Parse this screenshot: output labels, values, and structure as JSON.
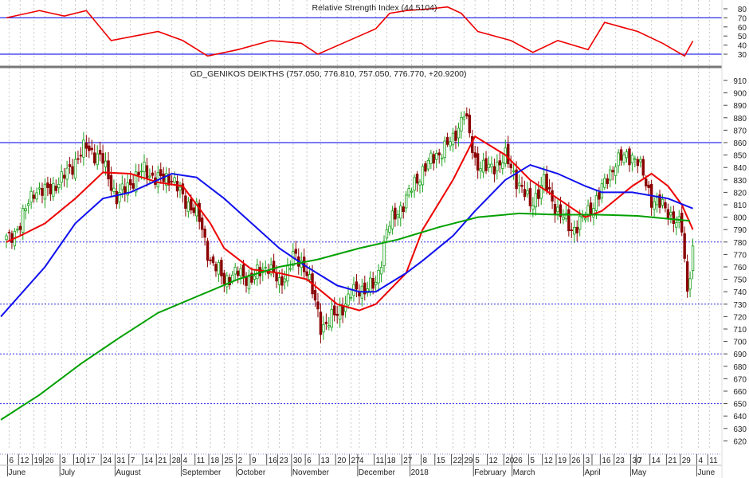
{
  "chart_data": [
    {
      "type": "line",
      "panel": "rsi",
      "title": "Relative Strength Index (44.5104)",
      "ylim": [
        20,
        85
      ],
      "yticks": [
        80,
        70,
        60,
        50,
        40,
        30
      ],
      "reference_lines": [
        70,
        30
      ],
      "colors": {
        "rsi": "#ee0000",
        "reference": "#2a2aee"
      },
      "series": [
        {
          "name": "RSI",
          "points": [
            [
              0,
              70
            ],
            [
              12,
              78
            ],
            [
              21,
              72
            ],
            [
              29,
              78
            ],
            [
              38,
              45
            ],
            [
              50,
              52
            ],
            [
              55,
              55
            ],
            [
              64,
              45
            ],
            [
              73,
              28
            ],
            [
              84,
              35
            ],
            [
              96,
              45
            ],
            [
              107,
              42
            ],
            [
              113,
              30
            ],
            [
              122,
              42
            ],
            [
              128,
              50
            ],
            [
              134,
              58
            ],
            [
              139,
              75
            ],
            [
              145,
              78
            ],
            [
              154,
              80
            ],
            [
              160,
              82
            ],
            [
              165,
              75
            ],
            [
              171,
              55
            ],
            [
              183,
              45
            ],
            [
              191,
              32
            ],
            [
              200,
              45
            ],
            [
              211,
              35
            ],
            [
              217,
              65
            ],
            [
              223,
              60
            ],
            [
              229,
              55
            ],
            [
              238,
              42
            ],
            [
              246,
              28
            ],
            [
              249,
              44.5
            ]
          ]
        }
      ]
    },
    {
      "type": "candlestick",
      "panel": "price",
      "title": "GD_GENIKOS DEIKTHS (757.050, 776.810, 757.050, 776.770, +20.9200)",
      "ylim": [
        610,
        915
      ],
      "yticks": [
        910,
        900,
        890,
        880,
        870,
        860,
        850,
        840,
        830,
        820,
        810,
        800,
        790,
        780,
        770,
        760,
        750,
        740,
        730,
        720,
        710,
        700,
        690,
        680,
        670,
        660,
        650,
        640,
        630,
        620
      ],
      "reference_lines": [
        {
          "value": 860,
          "style": "solid"
        },
        {
          "value": 780,
          "style": "dotted"
        },
        {
          "value": 730,
          "style": "dotted"
        },
        {
          "value": 690,
          "style": "dotted"
        },
        {
          "value": 650,
          "style": "dotted"
        }
      ],
      "colors": {
        "up": "#1aa11a",
        "down": "#8b0000",
        "ma_short": "#ee0000",
        "ma_mid": "#1010ee",
        "ma_long": "#00a000",
        "reference": "#2a2aee"
      },
      "close_points": [
        [
          1,
          782
        ],
        [
          5,
          795
        ],
        [
          10,
          822
        ],
        [
          14,
          820
        ],
        [
          20,
          830
        ],
        [
          25,
          845
        ],
        [
          29,
          857
        ],
        [
          35,
          845
        ],
        [
          40,
          815
        ],
        [
          45,
          828
        ],
        [
          50,
          838
        ],
        [
          55,
          830
        ],
        [
          60,
          832
        ],
        [
          64,
          815
        ],
        [
          69,
          805
        ],
        [
          74,
          765
        ],
        [
          79,
          750
        ],
        [
          84,
          755
        ],
        [
          89,
          750
        ],
        [
          95,
          762
        ],
        [
          99,
          745
        ],
        [
          104,
          768
        ],
        [
          109,
          758
        ],
        [
          114,
          712
        ],
        [
          120,
          722
        ],
        [
          125,
          738
        ],
        [
          128,
          742
        ],
        [
          134,
          745
        ],
        [
          138,
          790
        ],
        [
          145,
          815
        ],
        [
          151,
          838
        ],
        [
          156,
          850
        ],
        [
          162,
          862
        ],
        [
          166,
          885
        ],
        [
          170,
          845
        ],
        [
          175,
          838
        ],
        [
          181,
          848
        ],
        [
          184,
          835
        ],
        [
          190,
          810
        ],
        [
          195,
          828
        ],
        [
          200,
          805
        ],
        [
          205,
          790
        ],
        [
          210,
          800
        ],
        [
          216,
          822
        ],
        [
          221,
          845
        ],
        [
          227,
          850
        ],
        [
          229,
          845
        ],
        [
          234,
          815
        ],
        [
          240,
          805
        ],
        [
          245,
          790
        ],
        [
          247,
          740
        ],
        [
          249,
          776.77
        ]
      ],
      "last_bar": {
        "open": 757.05,
        "high": 776.81,
        "low": 757.05,
        "close": 776.77,
        "change": 20.92
      },
      "series": [
        {
          "name": "MA short",
          "color_key": "ma_short",
          "points": [
            [
              0,
              780
            ],
            [
              5,
              785
            ],
            [
              14,
              795
            ],
            [
              25,
              815
            ],
            [
              35,
              836
            ],
            [
              45,
              835
            ],
            [
              55,
              828
            ],
            [
              64,
              825
            ],
            [
              74,
              795
            ],
            [
              79,
              775
            ],
            [
              89,
              758
            ],
            [
              99,
              755
            ],
            [
              109,
              750
            ],
            [
              120,
              730
            ],
            [
              128,
              725
            ],
            [
              134,
              730
            ],
            [
              145,
              755
            ],
            [
              151,
              790
            ],
            [
              162,
              830
            ],
            [
              170,
              865
            ],
            [
              181,
              850
            ],
            [
              190,
              830
            ],
            [
              200,
              815
            ],
            [
              210,
              800
            ],
            [
              216,
              805
            ],
            [
              227,
              825
            ],
            [
              234,
              835
            ],
            [
              240,
              825
            ],
            [
              245,
              810
            ],
            [
              249,
              790
            ]
          ]
        },
        {
          "name": "MA mid",
          "color_key": "ma_mid",
          "points": [
            [
              -2,
              720
            ],
            [
              14,
              760
            ],
            [
              25,
              795
            ],
            [
              35,
              815
            ],
            [
              45,
              820
            ],
            [
              55,
              830
            ],
            [
              60,
              835
            ],
            [
              69,
              832
            ],
            [
              79,
              815
            ],
            [
              89,
              795
            ],
            [
              99,
              775
            ],
            [
              109,
              760
            ],
            [
              120,
              745
            ],
            [
              128,
              740
            ],
            [
              134,
              740
            ],
            [
              145,
              755
            ],
            [
              151,
              765
            ],
            [
              162,
              785
            ],
            [
              170,
              805
            ],
            [
              181,
              830
            ],
            [
              190,
              842
            ],
            [
              200,
              835
            ],
            [
              210,
              825
            ],
            [
              216,
              820
            ],
            [
              227,
              820
            ],
            [
              240,
              815
            ],
            [
              249,
              807
            ]
          ]
        },
        {
          "name": "MA long",
          "color_key": "ma_long",
          "points": [
            [
              -2,
              637
            ],
            [
              12,
              657
            ],
            [
              27,
              682
            ],
            [
              41,
              703
            ],
            [
              55,
              723
            ],
            [
              70,
              737
            ],
            [
              84,
              750
            ],
            [
              99,
              760
            ],
            [
              113,
              766
            ],
            [
              128,
              775
            ],
            [
              142,
              782
            ],
            [
              157,
              792
            ],
            [
              171,
              800
            ],
            [
              186,
              803
            ],
            [
              200,
              802
            ],
            [
              215,
              802
            ],
            [
              229,
              801
            ],
            [
              248,
              797
            ]
          ]
        }
      ],
      "xticks": [
        {
          "s": 1,
          "label": "6"
        },
        {
          "s": 5,
          "label": "12"
        },
        {
          "s": 10,
          "label": "19"
        },
        {
          "s": 14,
          "label": "26"
        },
        {
          "s": 20,
          "label": "3"
        },
        {
          "s": 25,
          "label": "10"
        },
        {
          "s": 29,
          "label": "17"
        },
        {
          "s": 35,
          "label": "24"
        },
        {
          "s": 40,
          "label": "31"
        },
        {
          "s": 45,
          "label": "7"
        },
        {
          "s": 50,
          "label": "14"
        },
        {
          "s": 55,
          "label": "21"
        },
        {
          "s": 60,
          "label": "28"
        },
        {
          "s": 64,
          "label": "4"
        },
        {
          "s": 69,
          "label": "11"
        },
        {
          "s": 74,
          "label": "18"
        },
        {
          "s": 79,
          "label": "25"
        },
        {
          "s": 84,
          "label": "2"
        },
        {
          "s": 89,
          "label": "9"
        },
        {
          "s": 95,
          "label": "16"
        },
        {
          "s": 99,
          "label": "23"
        },
        {
          "s": 104,
          "label": "30"
        },
        {
          "s": 109,
          "label": "6"
        },
        {
          "s": 114,
          "label": "13"
        },
        {
          "s": 120,
          "label": "20"
        },
        {
          "s": 125,
          "label": "27"
        },
        {
          "s": 128,
          "label": "4"
        },
        {
          "s": 134,
          "label": "11"
        },
        {
          "s": 138,
          "label": "18"
        },
        {
          "s": 144,
          "label": "27"
        },
        {
          "s": 147,
          "label": ""
        },
        {
          "s": 151,
          "label": "8"
        },
        {
          "s": 156,
          "label": "15"
        },
        {
          "s": 162,
          "label": "22"
        },
        {
          "s": 166,
          "label": "29"
        },
        {
          "s": 170,
          "label": "5"
        },
        {
          "s": 175,
          "label": "12"
        },
        {
          "s": 181,
          "label": "20"
        },
        {
          "s": 184,
          "label": "26"
        },
        {
          "s": 190,
          "label": "5"
        },
        {
          "s": 195,
          "label": "12"
        },
        {
          "s": 200,
          "label": "19"
        },
        {
          "s": 205,
          "label": "26"
        },
        {
          "s": 210,
          "label": "3"
        },
        {
          "s": 213,
          "label": ""
        },
        {
          "s": 216,
          "label": "16"
        },
        {
          "s": 221,
          "label": "23"
        },
        {
          "s": 227,
          "label": "30"
        },
        {
          "s": 229,
          "label": "7"
        },
        {
          "s": 234,
          "label": "14"
        },
        {
          "s": 240,
          "label": "21"
        },
        {
          "s": 245,
          "label": "29"
        },
        {
          "s": 251,
          "label": "4"
        },
        {
          "s": 255,
          "label": "11"
        }
      ],
      "months": [
        {
          "s": 1,
          "label": "June"
        },
        {
          "s": 20,
          "label": "July"
        },
        {
          "s": 40,
          "label": "August"
        },
        {
          "s": 64,
          "label": "September"
        },
        {
          "s": 84,
          "label": "October"
        },
        {
          "s": 104,
          "label": "November"
        },
        {
          "s": 128,
          "label": "December"
        },
        {
          "s": 147,
          "label": "2018"
        },
        {
          "s": 170,
          "label": "February"
        },
        {
          "s": 184,
          "label": "March"
        },
        {
          "s": 210,
          "label": "April"
        },
        {
          "s": 227,
          "label": "May"
        },
        {
          "s": 251,
          "label": "June"
        }
      ]
    }
  ]
}
